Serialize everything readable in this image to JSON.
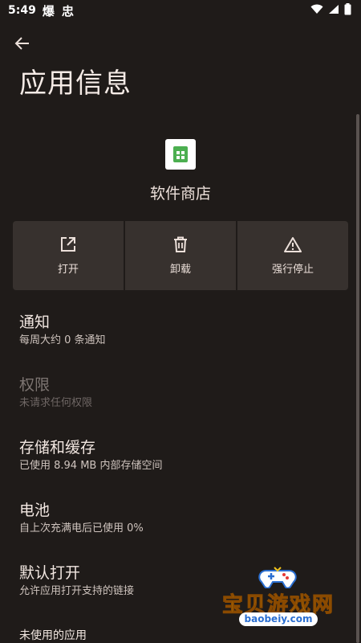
{
  "status_bar": {
    "time": "5:49",
    "notifications": "爆 忠"
  },
  "header": {
    "title": "应用信息"
  },
  "app": {
    "name": "软件商店",
    "icon": "store-app-icon"
  },
  "actions": [
    {
      "label": "打开",
      "icon": "open-external-icon"
    },
    {
      "label": "卸载",
      "icon": "trash-icon"
    },
    {
      "label": "强行停止",
      "icon": "warning-icon"
    }
  ],
  "settings": [
    {
      "title": "通知",
      "summary": "每周大约 0 条通知"
    },
    {
      "title": "权限",
      "summary": "未请求任何权限"
    },
    {
      "title": "存储和缓存",
      "summary": "已使用 8.94 MB 内部存储空间"
    },
    {
      "title": "电池",
      "summary": "自上次充满电后已使用 0%"
    },
    {
      "title": "默认打开",
      "summary": "允许应用打开支持的链接"
    },
    {
      "title": "未使用的应用"
    }
  ],
  "watermark": {
    "text": "宝贝游戏网",
    "url": "baobeiy.com"
  },
  "colors": {
    "background": "#1f1b19",
    "button_bg": "#37312e",
    "accent": "#4caf50"
  }
}
